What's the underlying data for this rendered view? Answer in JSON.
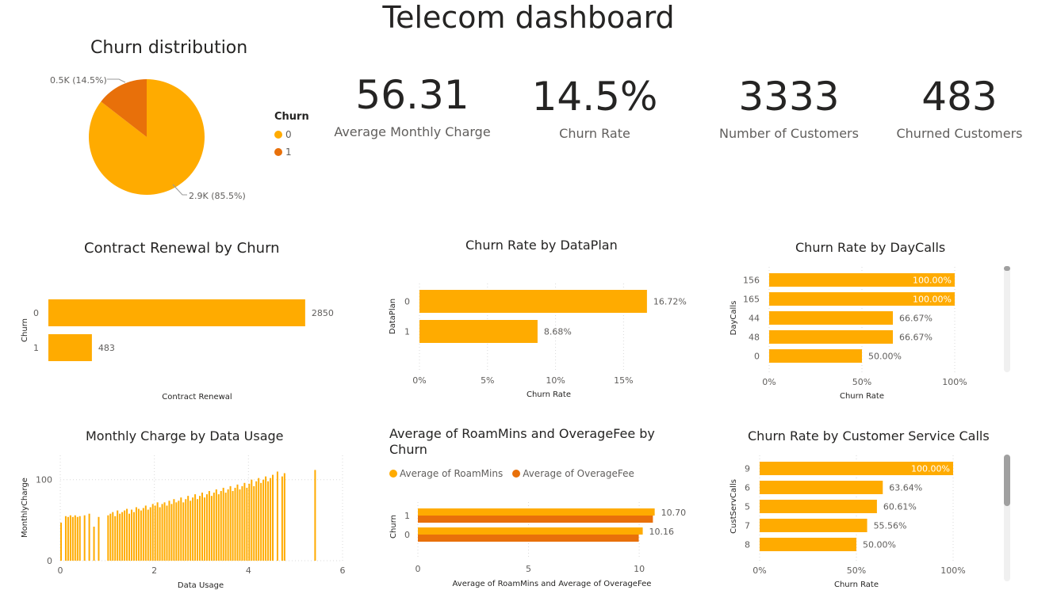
{
  "page": {
    "title": "Telecom dashboard"
  },
  "colors": {
    "series0": "#FFAB00",
    "series1": "#E8700A",
    "grid": "#d9d9d9",
    "axis_text": "#605e5c"
  },
  "kpis": [
    {
      "value": "56.31",
      "label": "Average Monthly Charge"
    },
    {
      "value": "14.5%",
      "label": "Churn Rate"
    },
    {
      "value": "3333",
      "label": "Number of Customers"
    },
    {
      "value": "483",
      "label": "Churned Customers"
    }
  ],
  "chart_data": [
    {
      "id": "churn-pie",
      "type": "pie",
      "title": "Churn distribution",
      "legend_title": "Churn",
      "legend_position": "right",
      "slices": [
        {
          "label": "0",
          "value": 2850,
          "display": "2.9K (85.5%)"
        },
        {
          "label": "1",
          "value": 483,
          "display": "0.5K (14.5%)"
        }
      ]
    },
    {
      "id": "contract-renewal",
      "type": "bar",
      "orientation": "horizontal",
      "title": "Contract Renewal by Churn",
      "xlabel": "Contract Renewal",
      "ylabel": "Churn",
      "categories": [
        "0",
        "1"
      ],
      "values": [
        2850,
        483
      ],
      "value_labels": [
        "2850",
        "483"
      ],
      "xlim": [
        0,
        3300
      ],
      "grid": false
    },
    {
      "id": "churn-dataplan",
      "type": "bar",
      "orientation": "horizontal",
      "title": "Churn Rate by DataPlan",
      "xlabel": "Churn Rate",
      "ylabel": "DataPlan",
      "categories": [
        "0",
        "1"
      ],
      "values": [
        16.72,
        8.68
      ],
      "value_labels": [
        "16.72%",
        "8.68%"
      ],
      "xticks": [
        "0%",
        "5%",
        "10%",
        "15%"
      ],
      "xtick_values": [
        0,
        5,
        10,
        15
      ],
      "xlim": [
        0,
        19
      ],
      "grid": true
    },
    {
      "id": "churn-daycalls",
      "type": "bar",
      "orientation": "horizontal",
      "title": "Churn Rate by DayCalls",
      "xlabel": "Churn Rate",
      "ylabel": "DayCalls",
      "categories": [
        "156",
        "165",
        "44",
        "48",
        "0"
      ],
      "values": [
        100,
        100,
        66.67,
        66.67,
        50
      ],
      "value_labels": [
        "100.00%",
        "100.00%",
        "66.67%",
        "66.67%",
        "50.00%"
      ],
      "xticks": [
        "0%",
        "50%",
        "100%"
      ],
      "xtick_values": [
        0,
        50,
        100
      ],
      "xlim": [
        0,
        100
      ],
      "grid": true
    },
    {
      "id": "monthly-charge",
      "type": "bar",
      "title": "Monthly Charge by Data Usage",
      "xlabel": "Data Usage",
      "ylabel": "MonthlyCharge",
      "xticks": [
        "0",
        "2",
        "4",
        "6"
      ],
      "xtick_values": [
        0,
        2,
        4,
        6
      ],
      "yticks": [
        "0",
        "100"
      ],
      "ytick_values": [
        0,
        100
      ],
      "xlim": [
        0,
        6
      ],
      "ylim": [
        0,
        130
      ],
      "grid": true,
      "x": [
        0.0,
        0.1,
        0.15,
        0.2,
        0.25,
        0.3,
        0.35,
        0.4,
        0.5,
        0.6,
        0.7,
        0.8,
        1.0,
        1.05,
        1.1,
        1.15,
        1.2,
        1.25,
        1.3,
        1.35,
        1.4,
        1.45,
        1.5,
        1.55,
        1.6,
        1.65,
        1.7,
        1.75,
        1.8,
        1.85,
        1.9,
        1.95,
        2.0,
        2.05,
        2.1,
        2.15,
        2.2,
        2.25,
        2.3,
        2.35,
        2.4,
        2.45,
        2.5,
        2.55,
        2.6,
        2.65,
        2.7,
        2.75,
        2.8,
        2.85,
        2.9,
        2.95,
        3.0,
        3.05,
        3.1,
        3.15,
        3.2,
        3.25,
        3.3,
        3.35,
        3.4,
        3.45,
        3.5,
        3.55,
        3.6,
        3.65,
        3.7,
        3.75,
        3.8,
        3.85,
        3.9,
        3.95,
        4.0,
        4.05,
        4.1,
        4.15,
        4.2,
        4.25,
        4.3,
        4.35,
        4.4,
        4.45,
        4.5,
        4.6,
        4.7,
        4.75,
        5.4
      ],
      "values": [
        47,
        55,
        54,
        56,
        54,
        56,
        54,
        55,
        56,
        58,
        42,
        54,
        56,
        58,
        60,
        55,
        62,
        58,
        60,
        62,
        64,
        58,
        63,
        60,
        66,
        64,
        62,
        65,
        68,
        63,
        66,
        70,
        68,
        72,
        66,
        70,
        72,
        68,
        74,
        70,
        76,
        72,
        74,
        78,
        72,
        76,
        80,
        74,
        78,
        82,
        76,
        80,
        84,
        78,
        82,
        86,
        80,
        84,
        88,
        82,
        86,
        90,
        84,
        88,
        92,
        86,
        90,
        94,
        88,
        92,
        96,
        90,
        95,
        100,
        92,
        98,
        102,
        96,
        100,
        104,
        98,
        102,
        106,
        110,
        104,
        108,
        112
      ]
    },
    {
      "id": "roam-overage",
      "type": "bar",
      "orientation": "horizontal",
      "title": "Average of RoamMins and OverageFee by Churn",
      "title_lines": [
        "Average of RoamMins and OverageFee by",
        "Churn"
      ],
      "xlabel": "Average of RoamMins and Average of OverageFee",
      "ylabel": "Churn",
      "categories": [
        "1",
        "0"
      ],
      "series": [
        {
          "name": "Average of RoamMins",
          "values": [
            10.7,
            10.16
          ]
        },
        {
          "name": "Average of OverageFee",
          "values": [
            10.62,
            9.98
          ]
        }
      ],
      "value_labels": [
        "10.70",
        "10.16"
      ],
      "xticks": [
        "0",
        "5",
        "10"
      ],
      "xtick_values": [
        0,
        5,
        10
      ],
      "xlim": [
        0,
        11
      ],
      "legend_position": "top-left",
      "grid": true
    },
    {
      "id": "churn-custserv",
      "type": "bar",
      "orientation": "horizontal",
      "title": "Churn Rate by Customer Service Calls",
      "xlabel": "Churn Rate",
      "ylabel": "CustServCalls",
      "categories": [
        "9",
        "6",
        "5",
        "7",
        "8"
      ],
      "values": [
        100,
        63.64,
        60.61,
        55.56,
        50
      ],
      "value_labels": [
        "100.00%",
        "63.64%",
        "60.61%",
        "55.56%",
        "50.00%"
      ],
      "xticks": [
        "0%",
        "50%",
        "100%"
      ],
      "xtick_values": [
        0,
        50,
        100
      ],
      "xlim": [
        0,
        100
      ],
      "grid": true
    }
  ]
}
